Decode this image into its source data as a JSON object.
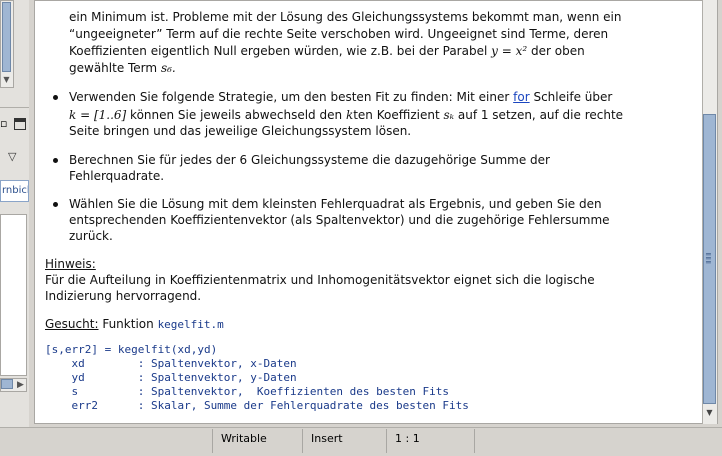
{
  "document": {
    "p1_line1": "ein Minimum ist. Probleme mit der Lösung des Gleichungssystems bekommt man, wenn ein",
    "p1_line2": "“ungeeigneter” Term auf die rechte Seite verschoben wird. Ungeeignet sind Terme, deren",
    "p1_line3": "Koeffizienten eigentlich Null ergeben würden, wie z.B. bei der Parabel",
    "p1_math1": "y = x²",
    "p1_line3b": "der oben",
    "p1_line4": "gewählte Term",
    "p1_math2": "s₆.",
    "b1_a": "Verwenden Sie folgende Strategie, um den besten Fit zu finden: Mit einer",
    "b1_link": "for",
    "b1_b": "Schleife über",
    "b1_math1": "k = [1..6]",
    "b1_c": "können Sie jeweils abwechseld den",
    "b1_math2": "k",
    "b1_d": "ten Koeffizient",
    "b1_math3": "sₖ",
    "b1_e": "auf 1 setzen, auf die rechte",
    "b1_f": "Seite bringen und das jeweilige Gleichungssystem lösen.",
    "b2_a": "Berechnen Sie für jedes der 6 Gleichungssysteme die dazugehörige Summe der",
    "b2_b": "Fehlerquadrate.",
    "b3_a": "Wählen Sie die Lösung mit dem kleinsten Fehlerquadrat als Ergebnis, und geben Sie den",
    "b3_b": "entsprechenden Koeffizientenvektor (als Spaltenvektor) und die zugehörige Fehlersumme",
    "b3_c": "zurück.",
    "hint_title": "Hinweis:",
    "hint_a": "Für die Aufteilung in Koeffizientenmatrix und Inhomogenitätsvektor eignet sich die logische",
    "hint_b": "Indizierung hervorragend.",
    "wanted_label": "Gesucht:",
    "wanted_text": "Funktion",
    "wanted_func": "kegelfit.m",
    "code": "[s,err2] = kegelfit(xd,yd)\n    xd        : Spaltenvektor, x-Daten\n    yd        : Spaltenvektor, y-Daten\n    s         : Spaltenvektor,  Koeffizienten des besten Fits\n    err2      : Skalar, Summe der Fehlerquadrate des besten Fits"
  },
  "left_panel": {
    "field_text": "rnbich"
  },
  "statusbar": {
    "mode": "Writable",
    "insert": "Insert",
    "position": "1 : 1"
  }
}
